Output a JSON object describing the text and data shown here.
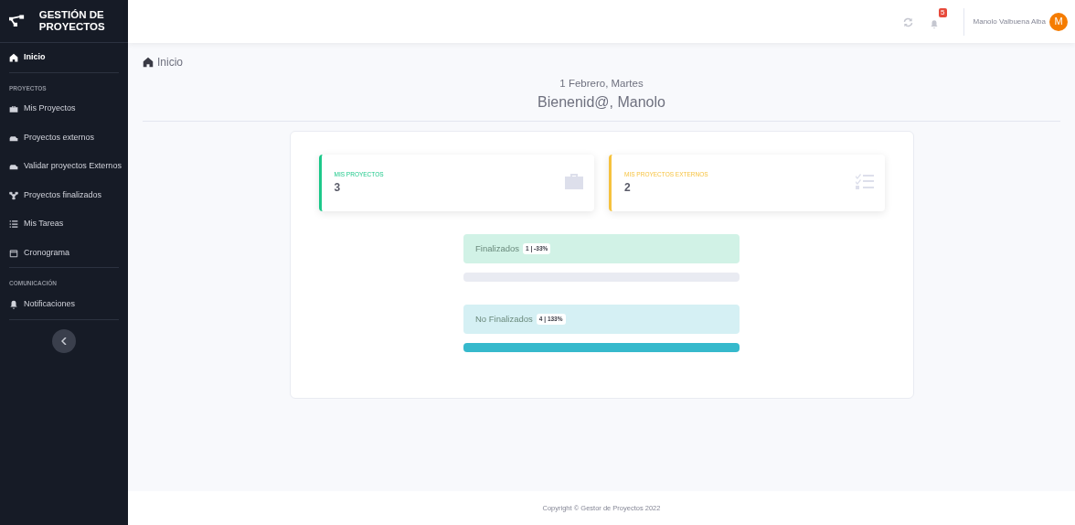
{
  "brand": {
    "title": "GESTIÓN DE PROYECTOS"
  },
  "sidebar": {
    "items": [
      {
        "kind": "link",
        "label": "Inicio",
        "selected": true
      },
      {
        "kind": "divider"
      },
      {
        "kind": "heading",
        "label": "PROYECTOS"
      },
      {
        "kind": "link",
        "label": "Mis Proyectos",
        "selected": false
      },
      {
        "kind": "link",
        "label": "Proyectos externos",
        "selected": false
      },
      {
        "kind": "link",
        "label": "Validar proyectos Externos",
        "selected": false
      },
      {
        "kind": "link",
        "label": "Proyectos finalizados",
        "selected": false
      },
      {
        "kind": "link",
        "label": "Mis Tareas",
        "selected": false
      },
      {
        "kind": "link",
        "label": "Cronograma",
        "selected": false
      },
      {
        "kind": "divider"
      },
      {
        "kind": "heading",
        "label": "COMUNICACIÓN"
      },
      {
        "kind": "link",
        "label": "Notificaciones",
        "selected": false
      },
      {
        "kind": "divider"
      }
    ]
  },
  "topbar": {
    "notification_count": "5",
    "user_name": "Manolo Valbuena Alba",
    "avatar_letter": "M"
  },
  "breadcrumb": "Inicio",
  "date": "1 Febrero, Martes",
  "welcome": "Bienenid@, Manolo",
  "stat_cards": [
    {
      "label": "MIS PROYECTOS",
      "value": "3",
      "color": "#1cc88a"
    },
    {
      "label": "MIS PROYECTOS EXTERNOS",
      "value": "2",
      "color": "#f6c23e"
    }
  ],
  "progress": [
    {
      "label": "Finalizados",
      "badge": "1 | -33%",
      "color": "#d1f2e6",
      "level": 0
    },
    {
      "label": "No Finalizados",
      "badge": "4 | 133%",
      "color": "#d5f0f4",
      "level": 1
    }
  ],
  "footer": "Copyright © Gestor de Proyectos 2022"
}
